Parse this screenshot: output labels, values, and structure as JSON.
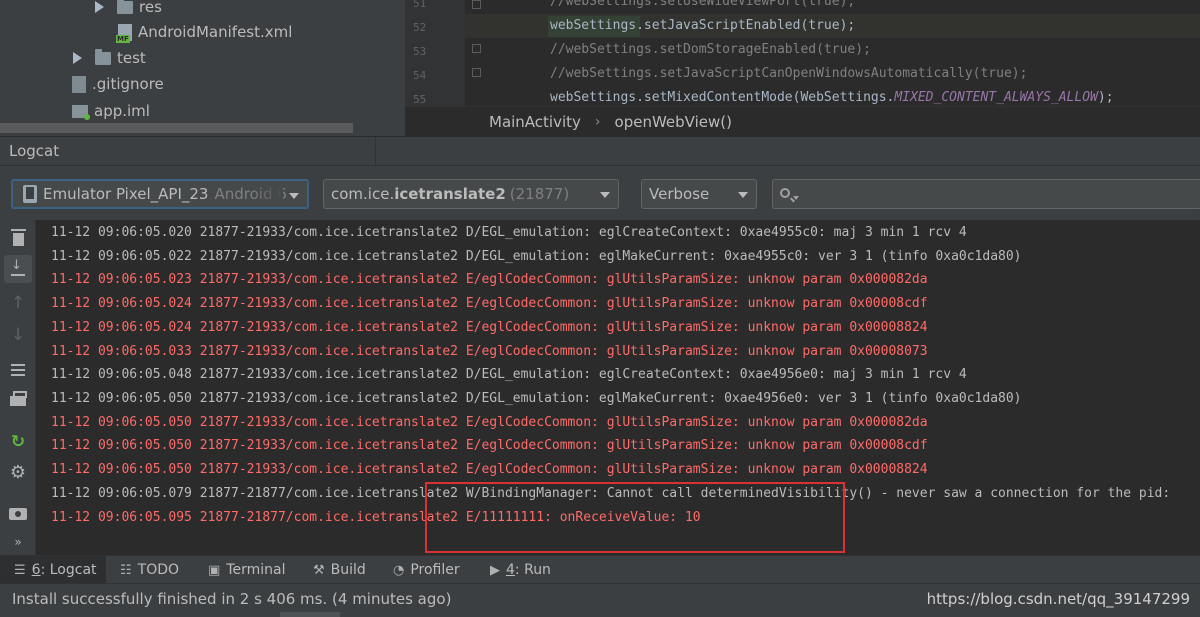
{
  "project_tree": {
    "items": [
      {
        "label": "res",
        "icon": "folder-icon"
      },
      {
        "label": "AndroidManifest.xml",
        "icon": "manifest-file-icon"
      },
      {
        "label": "test",
        "icon": "folder-icon"
      },
      {
        "label": ".gitignore",
        "icon": "file-icon"
      },
      {
        "label": "app.iml",
        "icon": "module-file-icon"
      }
    ]
  },
  "editor": {
    "line_numbers": [
      "51",
      "52",
      "53",
      "54",
      "55"
    ],
    "code_lines": [
      {
        "kind": "comment",
        "text": "//webSettings.setUseWideViewPort(true);"
      },
      {
        "kind": "code",
        "text": "webSettings.setJavaScriptEnabled(true);"
      },
      {
        "kind": "comment",
        "text": "//webSettings.setDomStorageEnabled(true);"
      },
      {
        "kind": "comment",
        "text": "//webSettings.setJavaScriptCanOpenWindowsAutomatically(true);"
      },
      {
        "kind": "code",
        "text_before": "webSettings.setMixedContentMode(WebSettings.",
        "text_field": "MIXED_CONTENT_ALWAYS_ALLOW",
        "text_after": ");"
      }
    ],
    "breadcrumb": [
      "MainActivity",
      "openWebView()"
    ]
  },
  "logcat": {
    "title": "Logcat",
    "device": {
      "name": "Emulator Pixel_API_23",
      "suffix": "Android 6"
    },
    "process": {
      "prefix": "com.ice.",
      "bold": "icetranslate2",
      "pid": "(21877)"
    },
    "level": "Verbose",
    "search": {
      "value": ""
    },
    "lines": [
      {
        "level": "D",
        "text": "11-12 09:06:05.020 21877-21933/com.ice.icetranslate2 D/EGL_emulation: eglCreateContext: 0xae4955c0: maj 3 min 1 rcv 4"
      },
      {
        "level": "D",
        "text": "11-12 09:06:05.022 21877-21933/com.ice.icetranslate2 D/EGL_emulation: eglMakeCurrent: 0xae4955c0: ver 3 1 (tinfo 0xa0c1da80)"
      },
      {
        "level": "E",
        "text": "11-12 09:06:05.023 21877-21933/com.ice.icetranslate2 E/eglCodecCommon: glUtilsParamSize: unknow param 0x000082da"
      },
      {
        "level": "E",
        "text": "11-12 09:06:05.024 21877-21933/com.ice.icetranslate2 E/eglCodecCommon: glUtilsParamSize: unknow param 0x00008cdf"
      },
      {
        "level": "E",
        "text": "11-12 09:06:05.024 21877-21933/com.ice.icetranslate2 E/eglCodecCommon: glUtilsParamSize: unknow param 0x00008824"
      },
      {
        "level": "E",
        "text": "11-12 09:06:05.033 21877-21933/com.ice.icetranslate2 E/eglCodecCommon: glUtilsParamSize: unknow param 0x00008073"
      },
      {
        "level": "D",
        "text": "11-12 09:06:05.048 21877-21933/com.ice.icetranslate2 D/EGL_emulation: eglCreateContext: 0xae4956e0: maj 3 min 1 rcv 4"
      },
      {
        "level": "D",
        "text": "11-12 09:06:05.050 21877-21933/com.ice.icetranslate2 D/EGL_emulation: eglMakeCurrent: 0xae4956e0: ver 3 1 (tinfo 0xa0c1da80)"
      },
      {
        "level": "E",
        "text": "11-12 09:06:05.050 21877-21933/com.ice.icetranslate2 E/eglCodecCommon: glUtilsParamSize: unknow param 0x000082da"
      },
      {
        "level": "E",
        "text": "11-12 09:06:05.050 21877-21933/com.ice.icetranslate2 E/eglCodecCommon: glUtilsParamSize: unknow param 0x00008cdf"
      },
      {
        "level": "E",
        "text": "11-12 09:06:05.050 21877-21933/com.ice.icetranslate2 E/eglCodecCommon: glUtilsParamSize: unknow param 0x00008824"
      },
      {
        "level": "W",
        "text": "11-12 09:06:05.079 21877-21877/com.ice.icetranslate2 W/BindingManager: Cannot call determinedVisibility() - never saw a connection for the pid:"
      },
      {
        "level": "E",
        "text": "11-12 09:06:05.095 21877-21877/com.ice.icetranslate2 E/11111111: onReceiveValue: 10"
      }
    ]
  },
  "tool_tabs": [
    {
      "num": "6",
      "label": ": Logcat",
      "icon": "logcat-icon"
    },
    {
      "label": "TODO",
      "icon": "todo-icon"
    },
    {
      "label": "Terminal",
      "icon": "terminal-icon"
    },
    {
      "label": "Build",
      "icon": "hammer-icon"
    },
    {
      "label": "Profiler",
      "icon": "gauge-icon"
    },
    {
      "num": "4",
      "label": ": Run",
      "icon": "run-icon"
    }
  ],
  "status": {
    "message": "Install successfully finished in 2 s 406 ms. (4 minutes ago)",
    "watermark": "https://blog.csdn.net/qq_39147299"
  },
  "colors": {
    "log_error": "#ff6b68",
    "log_default": "#bbbbbb",
    "annotation_box": "#d93232",
    "panel": "#3c3f41",
    "editor_bg": "#2b2b2b"
  }
}
